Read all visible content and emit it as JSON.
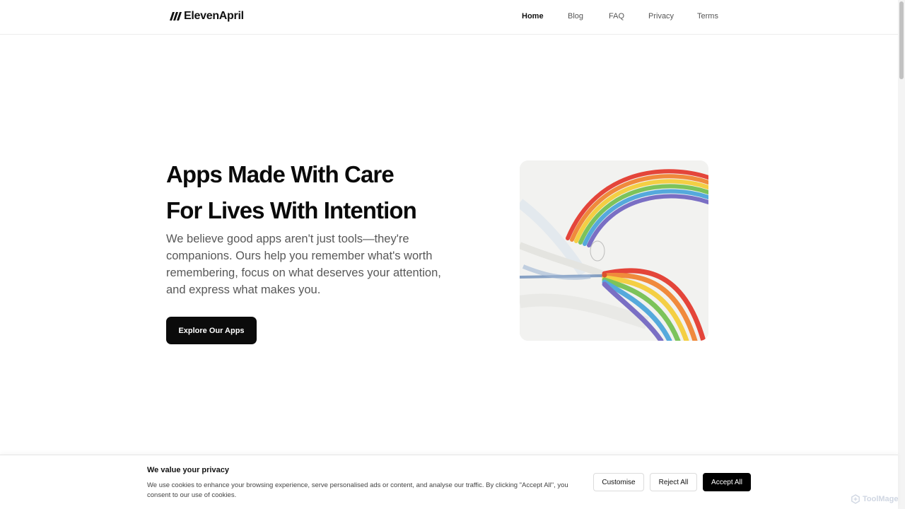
{
  "brand": {
    "name": "ElevenApril"
  },
  "nav": {
    "items": [
      {
        "label": "Home",
        "active": true
      },
      {
        "label": "Blog",
        "active": false
      },
      {
        "label": "FAQ",
        "active": false
      },
      {
        "label": "Privacy",
        "active": false
      },
      {
        "label": "Terms",
        "active": false
      }
    ]
  },
  "hero": {
    "title_line1": "Apps Made With Care",
    "title_line2": "For Lives With Intention",
    "description": "We believe good apps aren't just tools—they're companions. Ours help you remember what's worth remembering, focus on what deserves your attention, and express what makes you.",
    "cta_label": "Explore Our Apps",
    "image_icon": "rainbow-painting"
  },
  "cookie_banner": {
    "title": "We value your privacy",
    "text": "We use cookies to enhance your browsing experience, serve personalised ads or content, and analyse our traffic. By clicking \"Accept All\", you consent to our use of cookies.",
    "customise_label": "Customise",
    "reject_label": "Reject All",
    "accept_label": "Accept All"
  },
  "watermark": {
    "text": "ToolMage",
    "icon": "toolmage-logo-icon"
  },
  "colors": {
    "primary": "#0b0b0b",
    "text_muted": "#585858",
    "background": "#ffffff"
  }
}
